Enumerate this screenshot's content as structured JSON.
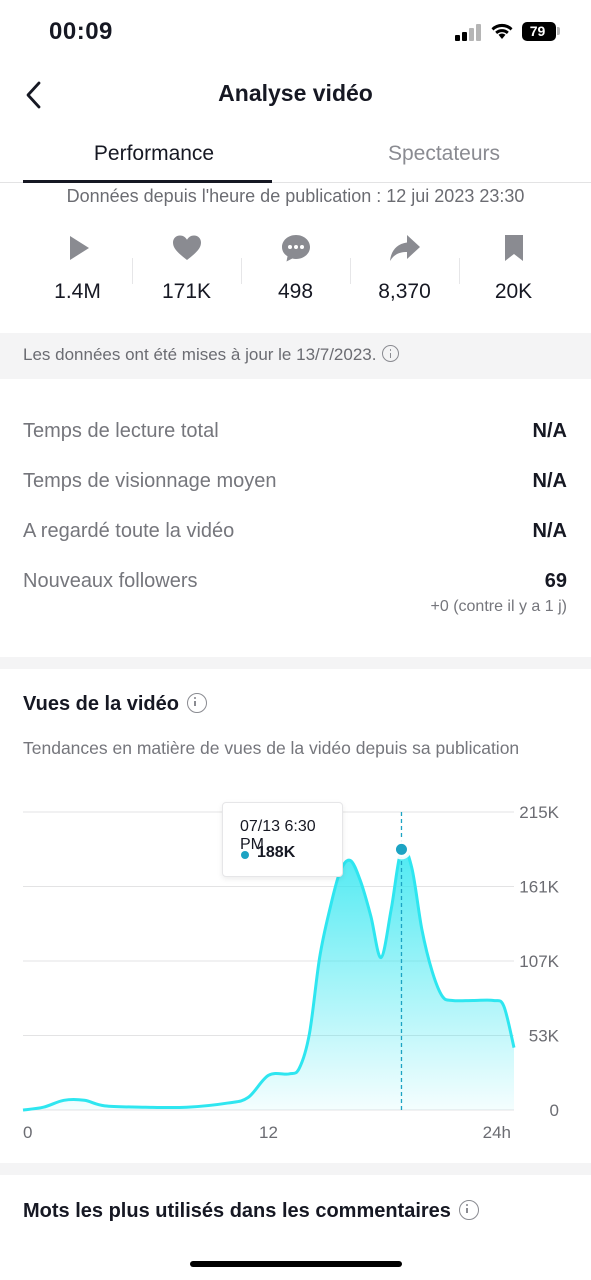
{
  "status_bar": {
    "time": "00:09",
    "battery": "79",
    "icons": [
      "cellular-signal-icon",
      "wifi-icon",
      "battery-icon"
    ]
  },
  "header": {
    "title": "Analyse vidéo",
    "back_icon": "chevron-left-icon"
  },
  "tabs": [
    {
      "label": "Performance",
      "active": true
    },
    {
      "label": "Spectateurs",
      "active": false
    }
  ],
  "published_text": "Données depuis l'heure de publication : 12 jui 2023 23:30",
  "stats": [
    {
      "icon": "play-icon",
      "value": "1.4M"
    },
    {
      "icon": "heart-icon",
      "value": "171K"
    },
    {
      "icon": "comment-icon",
      "value": "498"
    },
    {
      "icon": "share-icon",
      "value": "8,370"
    },
    {
      "icon": "bookmark-icon",
      "value": "20K"
    }
  ],
  "update_note": "Les données ont été mises à jour le 13/7/2023.",
  "metrics": [
    {
      "label": "Temps de lecture total",
      "value": "N/A"
    },
    {
      "label": "Temps de visionnage moyen",
      "value": "N/A"
    },
    {
      "label": "A regardé toute la vidéo",
      "value": "N/A"
    },
    {
      "label": "Nouveaux followers",
      "value": "69",
      "sub": "+0 (contre il y a 1 j)"
    }
  ],
  "views_section": {
    "title": "Vues de la vidéo",
    "description": "Tendances en matière de vues de la vidéo depuis sa publication"
  },
  "tooltip": {
    "date": "07/13 6:30 PM",
    "value": "188K"
  },
  "comments_section": {
    "title": "Mots les plus utilisés dans les commentaires"
  },
  "colors": {
    "accent": "#2ee6f0",
    "tooltip_dot": "#1ca3c3",
    "text_primary": "#161823",
    "text_secondary": "#75767c"
  },
  "chart_data": {
    "type": "area",
    "x_unit": "hours since publication",
    "x_ticks": [
      "0",
      "12",
      "24h"
    ],
    "y_ticks": [
      "0",
      "53K",
      "107K",
      "161K",
      "215K"
    ],
    "ylim": [
      0,
      215000
    ],
    "xlim": [
      0,
      24
    ],
    "grid": true,
    "highlight": {
      "x": 18.5,
      "y": 188000
    },
    "points": [
      [
        0,
        0
      ],
      [
        1,
        2000
      ],
      [
        2,
        7000
      ],
      [
        3,
        7000
      ],
      [
        4,
        3000
      ],
      [
        6,
        2000
      ],
      [
        8,
        2000
      ],
      [
        10,
        5000
      ],
      [
        11,
        9000
      ],
      [
        12,
        25000
      ],
      [
        13,
        26000
      ],
      [
        13.5,
        30000
      ],
      [
        14,
        55000
      ],
      [
        14.5,
        110000
      ],
      [
        15,
        145000
      ],
      [
        15.5,
        172000
      ],
      [
        16,
        180000
      ],
      [
        16.5,
        165000
      ],
      [
        17,
        140000
      ],
      [
        17.5,
        110000
      ],
      [
        18,
        145000
      ],
      [
        18.5,
        188000
      ],
      [
        19,
        175000
      ],
      [
        19.5,
        130000
      ],
      [
        20,
        100000
      ],
      [
        20.5,
        82000
      ],
      [
        21,
        79000
      ],
      [
        22,
        79000
      ],
      [
        23,
        79000
      ],
      [
        23.5,
        75000
      ],
      [
        24,
        45000
      ]
    ]
  }
}
